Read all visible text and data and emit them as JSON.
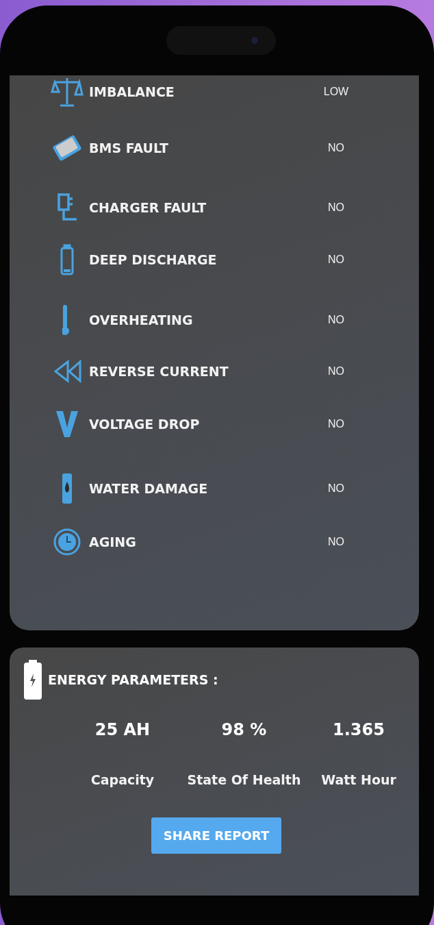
{
  "faults": [
    {
      "label": "IMBALANCE",
      "value": "LOW"
    },
    {
      "label": "BMS FAULT",
      "value": "NO"
    },
    {
      "label": "CHARGER FAULT",
      "value": "NO"
    },
    {
      "label": "DEEP DISCHARGE",
      "value": "NO"
    },
    {
      "label": "OVERHEATING",
      "value": "NO"
    },
    {
      "label": "REVERSE CURRENT",
      "value": "NO"
    },
    {
      "label": "VOLTAGE DROP",
      "value": "NO"
    },
    {
      "label": "WATER DAMAGE",
      "value": "NO"
    },
    {
      "label": "AGING",
      "value": "NO"
    }
  ],
  "energy": {
    "title": "ENERGY PARAMETERS :",
    "params": [
      {
        "value": "25 AH",
        "label": "Capacity"
      },
      {
        "value": "98 %",
        "label": "State Of Health"
      },
      {
        "value": "1.365",
        "label": "Watt Hour"
      }
    ],
    "button": "SHARE REPORT"
  }
}
